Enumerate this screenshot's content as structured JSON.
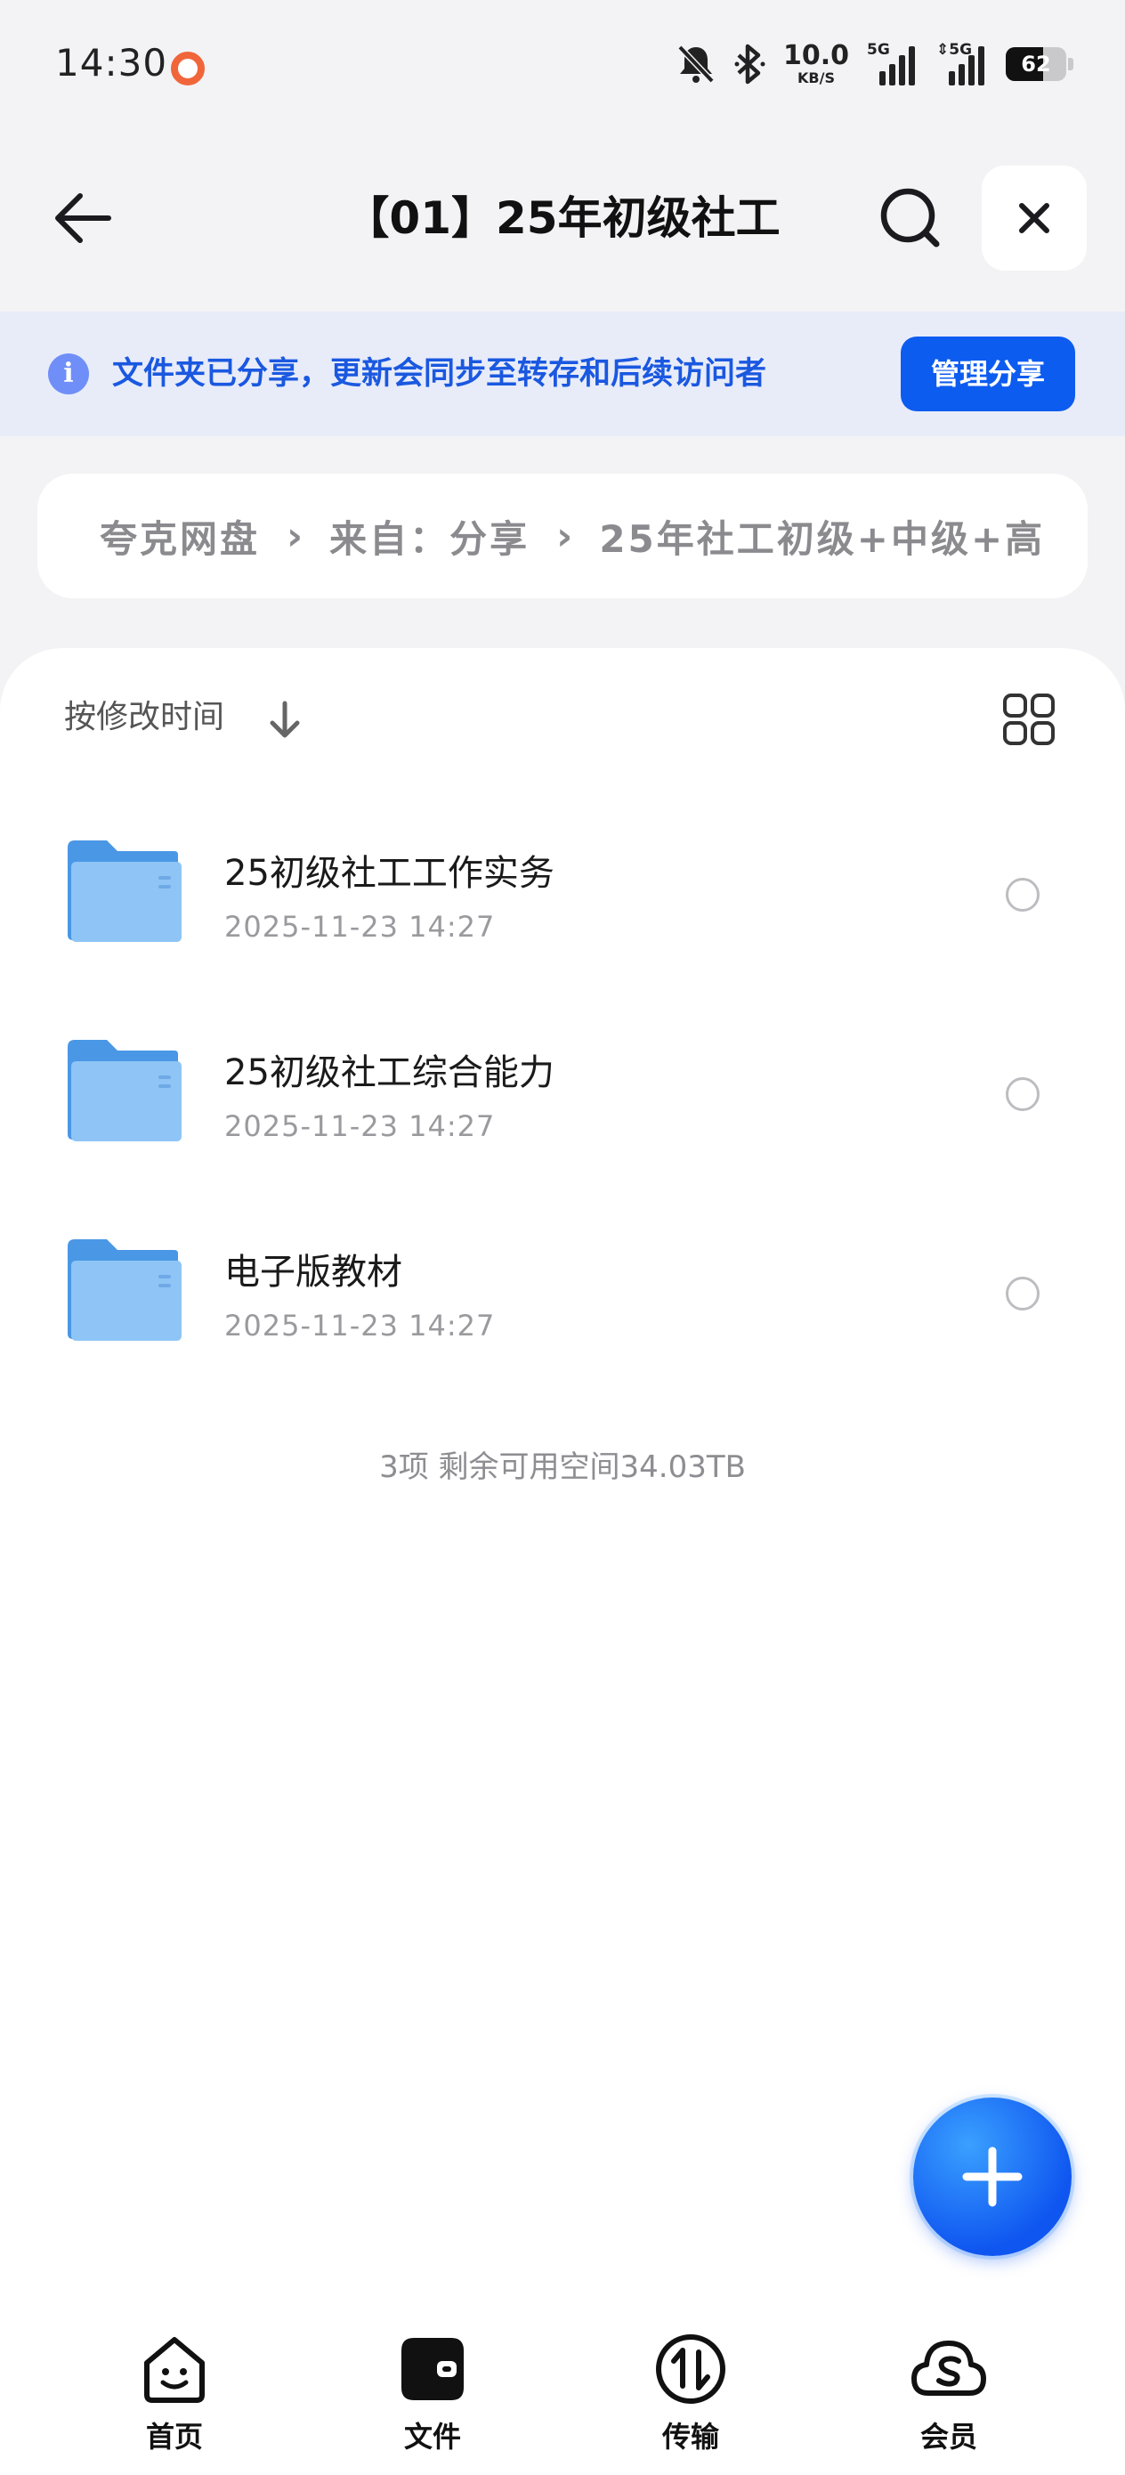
{
  "status_bar": {
    "time": "14:30",
    "net_speed_value": "10.0",
    "net_speed_unit": "KB/S",
    "signal1_tag": "5G",
    "signal2_tag": "5G",
    "battery_level": "62"
  },
  "header": {
    "title": "【01】25年初级社工"
  },
  "share_banner": {
    "message": "文件夹已分享，更新会同步至转存和后续访问者",
    "manage_label": "管理分享"
  },
  "breadcrumb": {
    "items": [
      "夸克网盘",
      "来自：分享",
      "25年社工初级+中级+高"
    ]
  },
  "list": {
    "sort_label": "按修改时间",
    "files": [
      {
        "name": "25初级社工工作实务",
        "date": "2025-11-23 14:27"
      },
      {
        "name": "25初级社工综合能力",
        "date": "2025-11-23 14:27"
      },
      {
        "name": "电子版教材",
        "date": "2025-11-23 14:27"
      }
    ],
    "summary": "3项 剩余可用空间34.03TB"
  },
  "bottom_nav": {
    "items": [
      {
        "label": "首页",
        "icon": "home-face-icon"
      },
      {
        "label": "文件",
        "icon": "wallet-file-icon"
      },
      {
        "label": "传输",
        "icon": "transfer-icon"
      },
      {
        "label": "会员",
        "icon": "cloud-member-icon"
      }
    ]
  },
  "colors": {
    "accent": "#0d5cf0",
    "banner_bg": "#e8ecf9",
    "banner_text": "#1a58e0",
    "folder": "#5aa7ee"
  }
}
